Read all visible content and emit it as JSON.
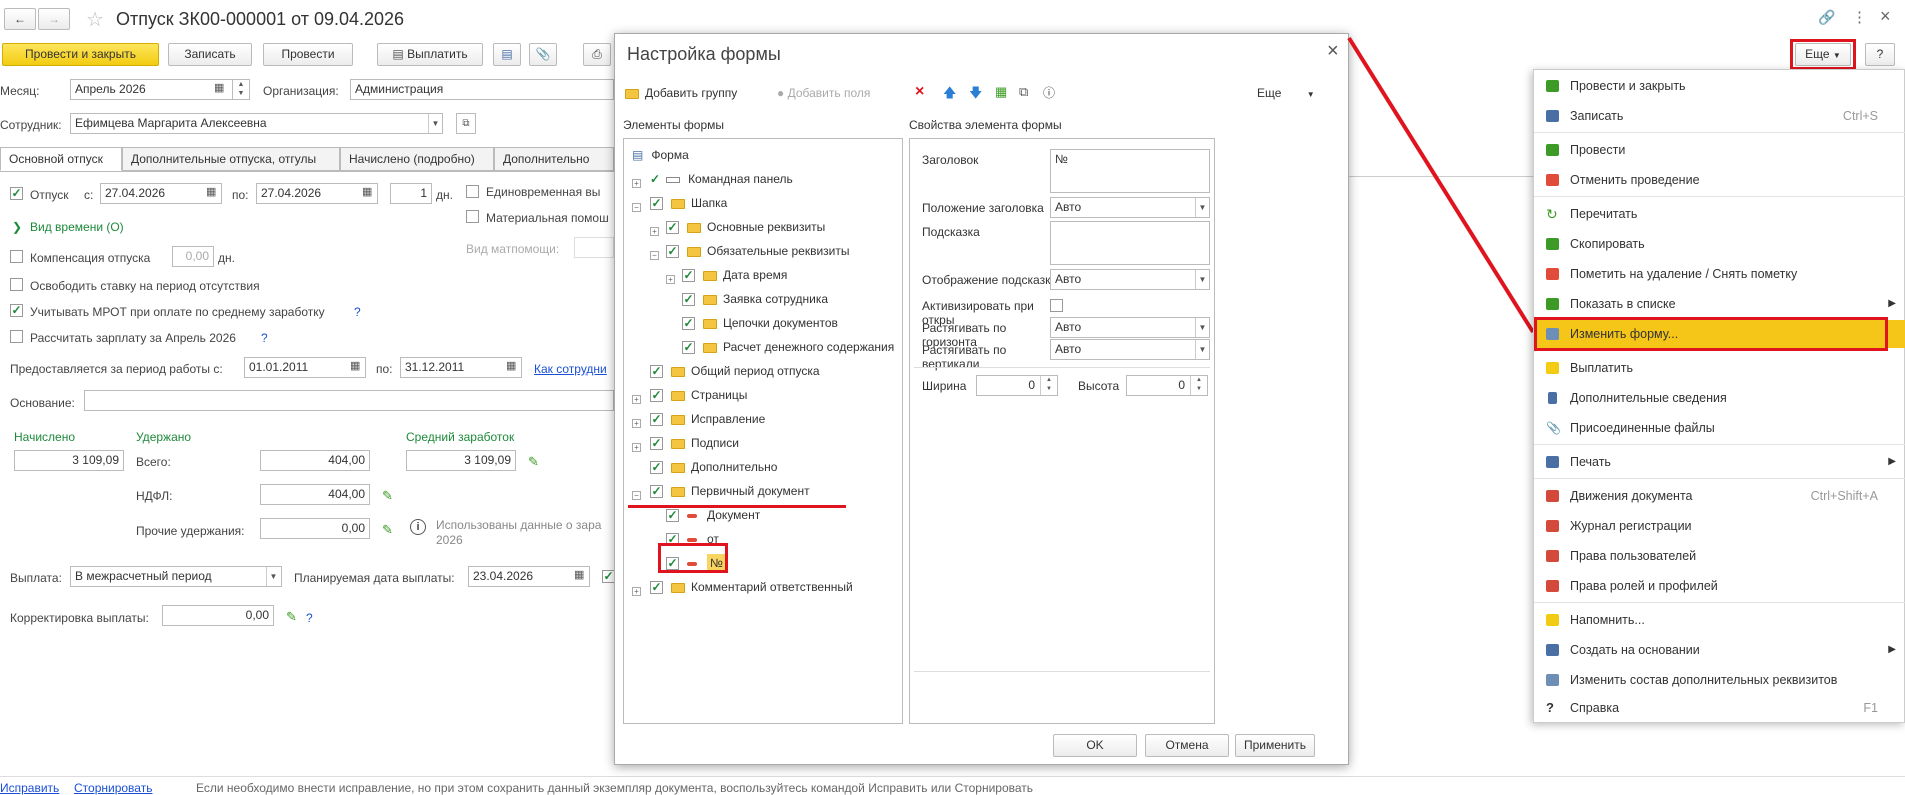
{
  "window": {
    "title": "Отпуск ЗК00-000001 от 09.04.2026",
    "more_label": "Еще",
    "help_label": "?"
  },
  "toolbar": {
    "post_close": "Провести и закрыть",
    "write": "Записать",
    "post": "Провести",
    "pay": "Выплатить"
  },
  "form": {
    "month_label": "Месяц:",
    "month_value": "Апрель 2026",
    "org_label": "Организация:",
    "org_value": "Администрация",
    "employee_label": "Сотрудник:",
    "employee_value": "Ефимцева Маргарита Алексеевна",
    "tabs": [
      "Основной отпуск",
      "Дополнительные отпуска, отгулы",
      "Начислено (подробно)",
      "Дополнительно"
    ],
    "vacation_label": "Отпуск",
    "from_label": "с:",
    "from_value": "27.04.2026",
    "to_label": "по:",
    "to_value": "27.04.2026",
    "days_value": "1",
    "days_unit": "дн.",
    "lump_sum": "Единовременная вы",
    "material_help": "Материальная помош",
    "material_kind_label": "Вид матпомощи:",
    "time_kind": "Вид времени (О)",
    "compensation": "Компенсация отпуска",
    "compensation_value": "0,00",
    "compensation_unit": "дн.",
    "release_rate": "Освободить ставку на период отсутствия",
    "mrot": "Учитывать МРОТ при оплате по среднему заработку",
    "calc_salary": "Рассчитать зарплату за Апрель 2026",
    "period_label": "Предоставляется за период работы с:",
    "period_from": "01.01.2011",
    "period_to_label": "по:",
    "period_to": "31.12.2011",
    "period_link": "Как сотрудни",
    "basis_label": "Основание:",
    "accrued_label": "Начислено",
    "accrued_value": "3 109,09",
    "withheld_label": "Удержано",
    "total_label": "Всего:",
    "total_value": "404,00",
    "ndfl_label": "НДФЛ:",
    "ndfl_value": "404,00",
    "other_label": "Прочие удержания:",
    "other_value": "0,00",
    "avg_label": "Средний заработок",
    "avg_value": "3 109,09",
    "info_text_1": "Использованы данные о зара",
    "info_text_2": "2026",
    "payout_label": "Выплата:",
    "payout_value": "В межрасчетный период",
    "planned_label": "Планируемая дата выплаты:",
    "planned_value": "23.04.2026",
    "correction_label": "Корректировка выплаты:",
    "correction_value": "0,00",
    "footer_link1": "Исправить",
    "footer_link2": "Сторнировать",
    "footer_text": "Если необходимо внести исправление, но при этом сохранить данный экземпляр документа, воспользуйтесь командой Исправить или Сторнировать"
  },
  "dialog": {
    "title": "Настройка формы",
    "add_group": "Добавить группу",
    "add_fields": "Добавить поля",
    "more": "Еще",
    "elements_title": "Элементы формы",
    "props_title": "Свойства элемента формы",
    "tree": [
      "Форма",
      "Командная панель",
      "Шапка",
      "Основные реквизиты",
      "Обязательные реквизиты",
      "Дата время",
      "Заявка сотрудника",
      "Цепочки документов",
      "Расчет денежного содержания",
      "Общий период отпуска",
      "Страницы",
      "Исправление",
      "Подписи",
      "Дополнительно",
      "Первичный документ",
      "Документ",
      "от",
      "№",
      "Комментарий ответственный"
    ],
    "props": {
      "title_label": "Заголовок",
      "title_value": "№",
      "title_pos_label": "Положение заголовка",
      "title_pos_value": "Авто",
      "hint_label": "Подсказка",
      "hint_display_label": "Отображение подсказки",
      "hint_display_value": "Авто",
      "activate_label": "Активизировать при откры",
      "stretch_h_label": "Растягивать по горизонта",
      "stretch_h_value": "Авто",
      "stretch_v_label": "Растягивать по вертикали",
      "stretch_v_value": "Авто",
      "width_label": "Ширина",
      "width_value": "0",
      "height_label": "Высота",
      "height_value": "0"
    },
    "ok": "OK",
    "cancel": "Отмена",
    "apply": "Применить"
  },
  "menu": {
    "items": [
      {
        "label": "Провести и закрыть",
        "shortcut": ""
      },
      {
        "label": "Записать",
        "shortcut": "Ctrl+S"
      },
      {
        "label": "Провести",
        "shortcut": ""
      },
      {
        "label": "Отменить проведение",
        "shortcut": ""
      },
      {
        "label": "Перечитать",
        "shortcut": ""
      },
      {
        "label": "Скопировать",
        "shortcut": ""
      },
      {
        "label": "Пометить на удаление / Снять пометку",
        "shortcut": ""
      },
      {
        "label": "Показать в списке",
        "shortcut": ""
      },
      {
        "label": "Изменить форму...",
        "shortcut": ""
      },
      {
        "label": "Выплатить",
        "shortcut": ""
      },
      {
        "label": "Дополнительные сведения",
        "shortcut": ""
      },
      {
        "label": "Присоединенные файлы",
        "shortcut": ""
      },
      {
        "label": "Печать",
        "shortcut": ""
      },
      {
        "label": "Движения документа",
        "shortcut": "Ctrl+Shift+A"
      },
      {
        "label": "Журнал регистрации",
        "shortcut": ""
      },
      {
        "label": "Права пользователей",
        "shortcut": ""
      },
      {
        "label": "Права ролей и профилей",
        "shortcut": ""
      },
      {
        "label": "Напомнить...",
        "shortcut": ""
      },
      {
        "label": "Создать на основании",
        "shortcut": ""
      },
      {
        "label": "Изменить состав дополнительных реквизитов",
        "shortcut": ""
      },
      {
        "label": "Справка",
        "shortcut": "F1"
      }
    ]
  },
  "colors": {
    "accent_yellow": "#f5c518",
    "highlight_red": "#e0141e",
    "link_blue": "#1a4fd6",
    "green": "#1d8a3a"
  }
}
